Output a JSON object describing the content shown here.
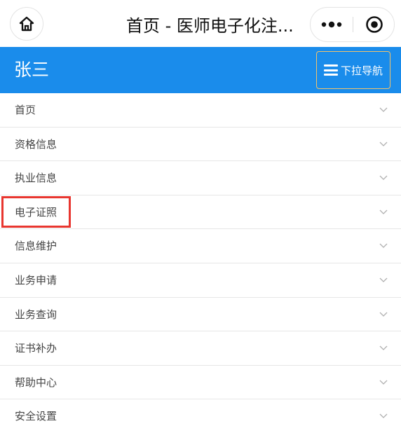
{
  "topbar": {
    "title": "首页 - 医师电子化注...",
    "home_icon": "home-icon",
    "more_icon": "more-dots-icon",
    "close_icon": "target-close-icon"
  },
  "header": {
    "user_name": "张三",
    "nav_button_label": "下拉导航",
    "nav_icon": "menu-icon",
    "background_color": "#1a8ceb",
    "nav_button_border_color": "#f2c36b"
  },
  "menu": {
    "items": [
      {
        "label": "首页"
      },
      {
        "label": "资格信息"
      },
      {
        "label": "执业信息"
      },
      {
        "label": "电子证照",
        "highlighted": true
      },
      {
        "label": "信息维护"
      },
      {
        "label": "业务申请"
      },
      {
        "label": "业务查询"
      },
      {
        "label": "证书补办"
      },
      {
        "label": "帮助中心"
      },
      {
        "label": "安全设置"
      }
    ],
    "chevron_icon": "chevron-down-icon",
    "highlight_color": "#e8362f"
  }
}
